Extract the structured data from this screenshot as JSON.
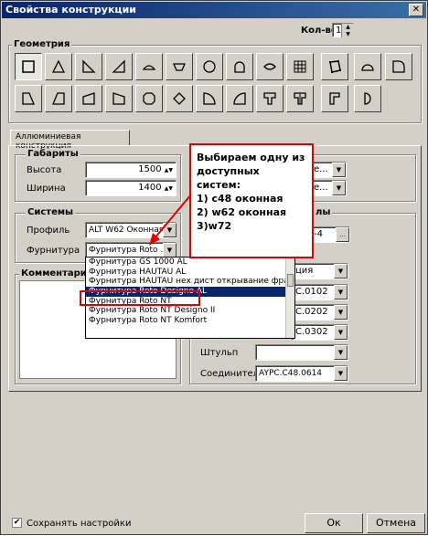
{
  "window": {
    "title": "Свойства конструкции",
    "close": "✕"
  },
  "qty": {
    "label": "Кол-во",
    "value": "1"
  },
  "geometry": {
    "title": "Геометрия"
  },
  "tab": {
    "label": "Аллюминиевая конструкция"
  },
  "dimensions": {
    "title": "Габариты",
    "height_label": "Высота",
    "height_value": "1500",
    "width_label": "Ширина",
    "width_value": "1400"
  },
  "systems": {
    "title": "Системы",
    "profile_label": "Профиль",
    "profile_value": "ALT W62 Оконная",
    "hardware_label": "Фурнитура",
    "hardware_value": "Фурнитура Roto ..."
  },
  "comment": {
    "title": "Комментарий"
  },
  "dropdown_list": [
    "Фурнитура GS 1000 AL",
    "Фурнитура HAUTAU AL",
    "Фурнитура HAUTAU нех дист открывание фрамуг",
    "Фурнитура Roto Designo AL",
    "Фурнитура Roto NT",
    "Фурнитура Roto NT Designo II",
    "Фурнитура Roto NT Komfort"
  ],
  "selected_item": "Фурнитура Roto Designo AL",
  "callout": [
    "Выбираем одну из",
    "доступных систем:",
    "1) c48 оконная",
    "2) w62 оконная",
    "3)w72"
  ],
  "right_panel": {
    "field1_value": "е...",
    "field2_value": "е...",
    "section_label": "лы",
    "field3_value": "-4",
    "field4_value": "ция",
    "field5_value": "С.0102",
    "field6_value": "С.0202",
    "field7_value": "С.0302",
    "shtulp_label": "Штульп",
    "shtulp_value": "",
    "connector_label": "Соединитель",
    "connector_value": "AYPC.C48.0614"
  },
  "footer": {
    "save_settings": "Сохранять настройки",
    "ok": "Ок",
    "cancel": "Отмена"
  }
}
